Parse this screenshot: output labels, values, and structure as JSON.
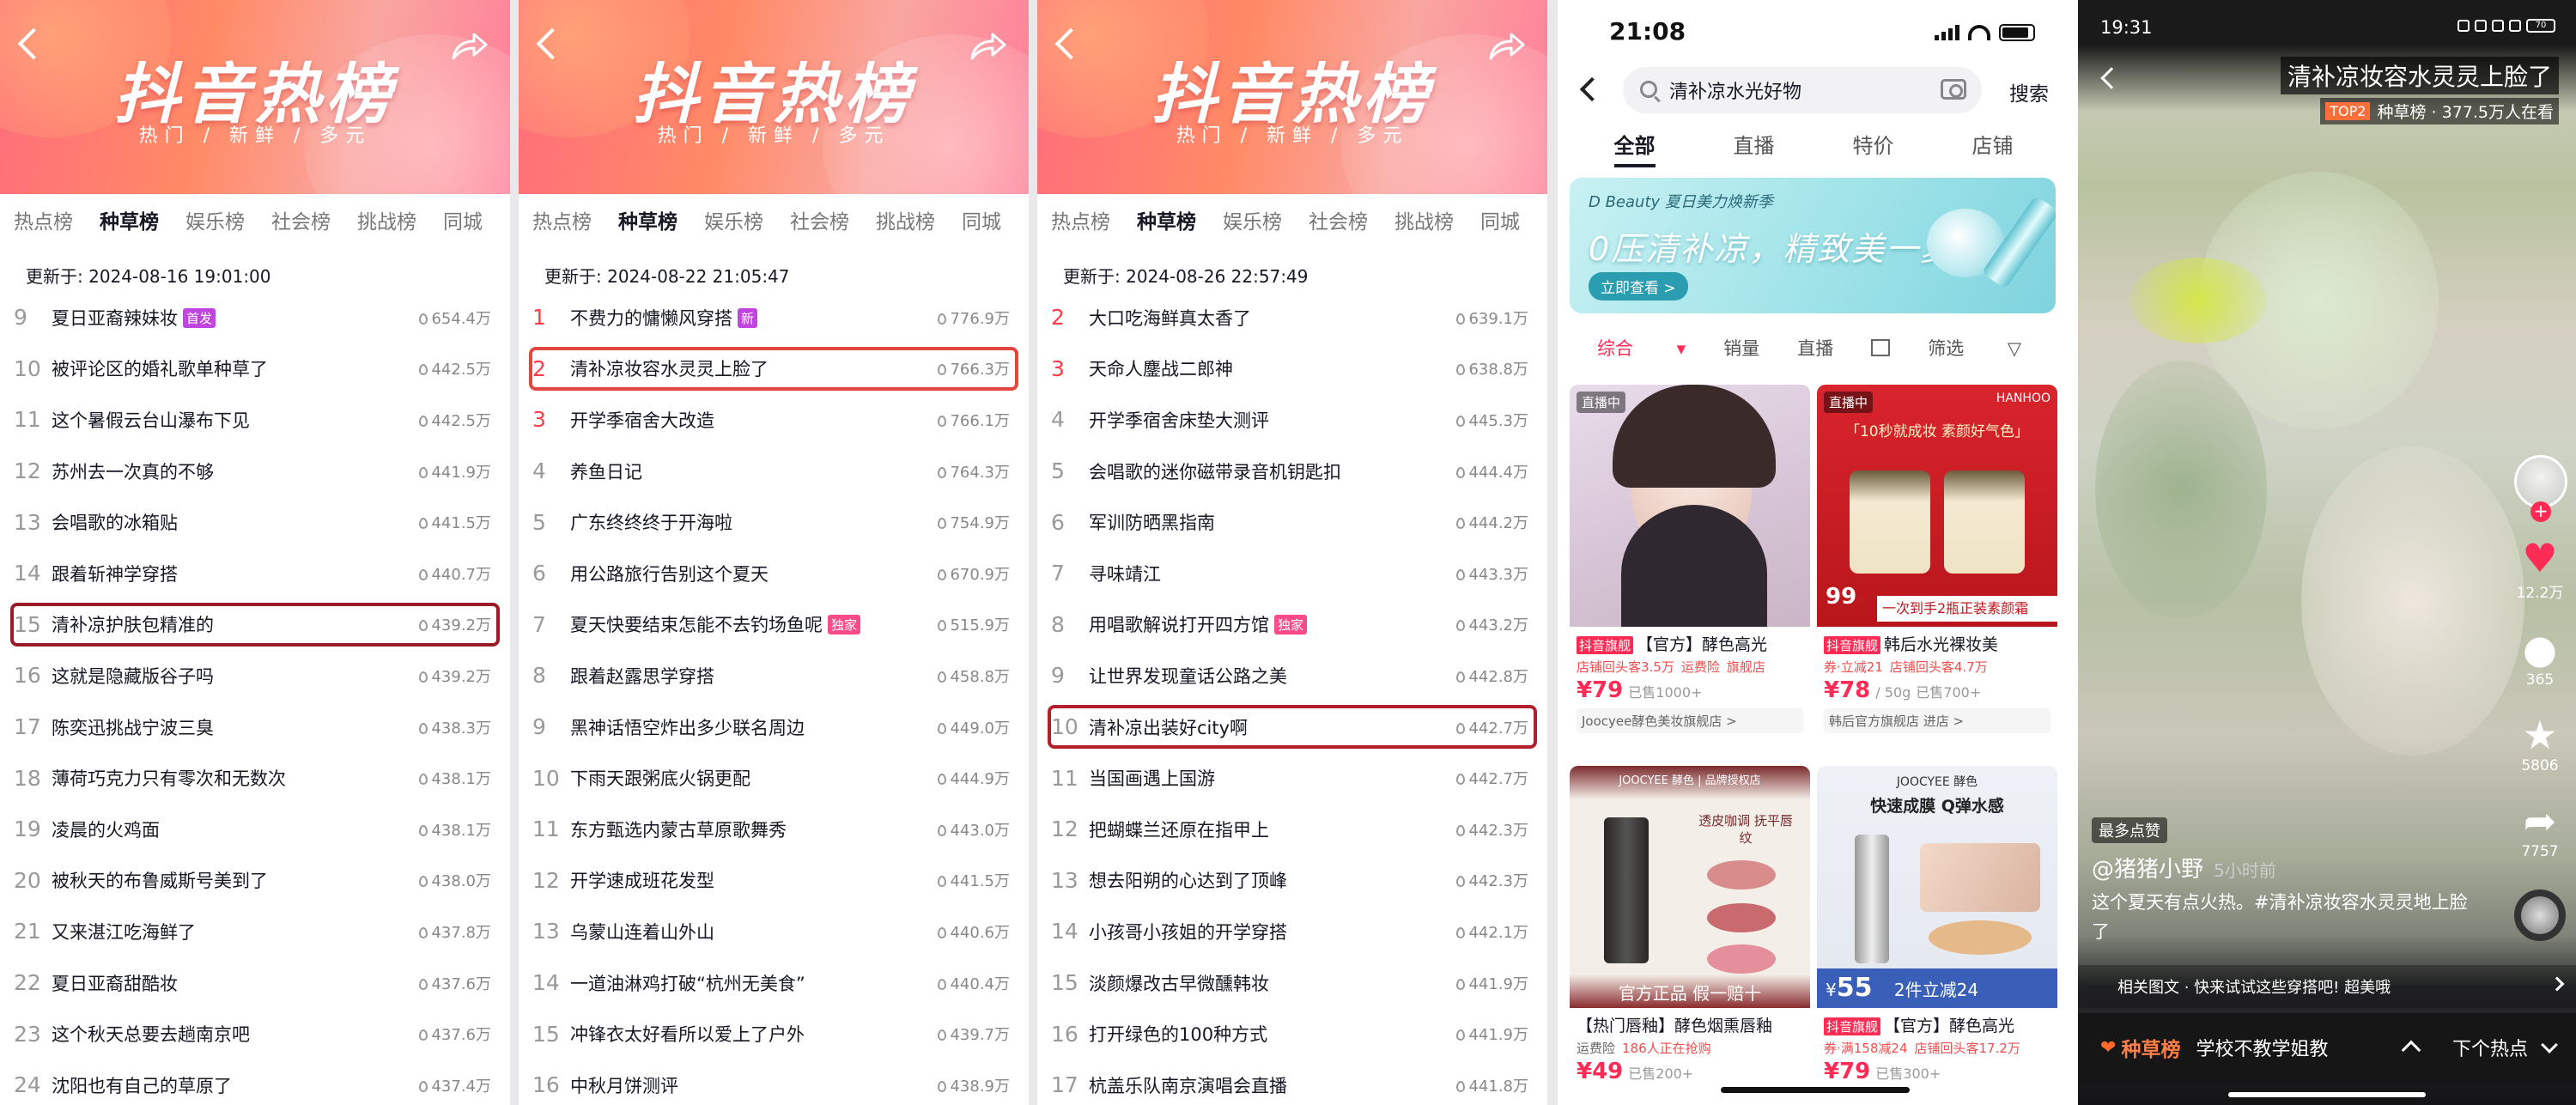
{
  "lists": [
    {
      "banner_title": "抖音热榜",
      "banner_sub": "热门 / 新鲜 / 多元",
      "tabs": [
        "热点榜",
        "种草榜",
        "娱乐榜",
        "社会榜",
        "挑战榜",
        "同城"
      ],
      "active_tab": "种草榜",
      "updated": "更新于:   2024-08-16 19:01:00",
      "rows": [
        {
          "rank": "9",
          "title": "夏日亚裔辣妹妆",
          "badge": "首发",
          "heat": "654.4万"
        },
        {
          "rank": "10",
          "title": "被评论区的婚礼歌单种草了",
          "heat": "442.5万"
        },
        {
          "rank": "11",
          "title": "这个暑假云台山瀑布下见",
          "heat": "442.5万"
        },
        {
          "rank": "12",
          "title": "苏州去一次真的不够",
          "heat": "441.9万"
        },
        {
          "rank": "13",
          "title": "会唱歌的冰箱贴",
          "heat": "441.5万"
        },
        {
          "rank": "14",
          "title": "跟着斩神学穿搭",
          "heat": "440.7万"
        },
        {
          "rank": "15",
          "title": "清补凉护肤包精准的",
          "heat": "439.2万",
          "boxed": true
        },
        {
          "rank": "16",
          "title": "这就是隐藏版谷子吗",
          "heat": "439.2万"
        },
        {
          "rank": "17",
          "title": "陈奕迅挑战宁波三臭",
          "heat": "438.3万"
        },
        {
          "rank": "18",
          "title": "薄荷巧克力只有零次和无数次",
          "heat": "438.1万"
        },
        {
          "rank": "19",
          "title": "凌晨的火鸡面",
          "heat": "438.1万"
        },
        {
          "rank": "20",
          "title": "被秋天的布鲁威斯号美到了",
          "heat": "438.0万"
        },
        {
          "rank": "21",
          "title": "又来湛江吃海鲜了",
          "heat": "437.8万"
        },
        {
          "rank": "22",
          "title": "夏日亚裔甜酷妆",
          "heat": "437.6万"
        },
        {
          "rank": "23",
          "title": "这个秋天总要去趟南京吧",
          "heat": "437.6万"
        },
        {
          "rank": "24",
          "title": "沈阳也有自己的草原了",
          "heat": "437.4万"
        }
      ]
    },
    {
      "banner_title": "抖音热榜",
      "banner_sub": "热门 / 新鲜 / 多元",
      "tabs": [
        "热点榜",
        "种草榜",
        "娱乐榜",
        "社会榜",
        "挑战榜",
        "同城"
      ],
      "active_tab": "种草榜",
      "updated": "更新于:   2024-08-22 21:05:47",
      "rows": [
        {
          "rank": "1",
          "title": "不费力的慵懒风穿搭",
          "badge": "新",
          "heat": "776.9万",
          "top": true
        },
        {
          "rank": "2",
          "title": "清补凉妆容水灵灵上脸了",
          "heat": "766.3万",
          "top": true,
          "boxed": true
        },
        {
          "rank": "3",
          "title": "开学季宿舍大改造",
          "heat": "766.1万",
          "top": true
        },
        {
          "rank": "4",
          "title": "养鱼日记",
          "heat": "764.3万"
        },
        {
          "rank": "5",
          "title": "广东终终终于开海啦",
          "heat": "754.9万"
        },
        {
          "rank": "6",
          "title": "用公路旅行告别这个夏天",
          "heat": "670.9万"
        },
        {
          "rank": "7",
          "title": "夏天快要结束怎能不去钓场鱼呢",
          "badge": "独家",
          "excl": true,
          "heat": "515.9万"
        },
        {
          "rank": "8",
          "title": "跟着赵露思学穿搭",
          "heat": "458.8万"
        },
        {
          "rank": "9",
          "title": "黑神话悟空炸出多少联名周边",
          "heat": "449.0万"
        },
        {
          "rank": "10",
          "title": "下雨天跟粥底火锅更配",
          "heat": "444.9万"
        },
        {
          "rank": "11",
          "title": "东方甄选内蒙古草原歌舞秀",
          "heat": "443.0万"
        },
        {
          "rank": "12",
          "title": "开学速成班花发型",
          "heat": "441.5万"
        },
        {
          "rank": "13",
          "title": "乌蒙山连着山外山",
          "heat": "440.6万"
        },
        {
          "rank": "14",
          "title": "一道油淋鸡打破“杭州无美食”",
          "heat": "440.4万"
        },
        {
          "rank": "15",
          "title": "冲锋衣太好看所以爱上了户外",
          "heat": "439.7万"
        },
        {
          "rank": "16",
          "title": "中秋月饼测评",
          "heat": "438.9万"
        }
      ]
    },
    {
      "banner_title": "抖音热榜",
      "banner_sub": "热门 / 新鲜 / 多元",
      "tabs": [
        "热点榜",
        "种草榜",
        "娱乐榜",
        "社会榜",
        "挑战榜",
        "同城"
      ],
      "active_tab": "种草榜",
      "updated": "更新于:   2024-08-26 22:57:49",
      "rows": [
        {
          "rank": "2",
          "title": "大口吃海鲜真太香了",
          "heat": "639.1万",
          "top": true
        },
        {
          "rank": "3",
          "title": "天命人鏖战二郎神",
          "heat": "638.8万",
          "top": true
        },
        {
          "rank": "4",
          "title": "开学季宿舍床垫大测评",
          "heat": "445.3万"
        },
        {
          "rank": "5",
          "title": "会唱歌的迷你磁带录音机钥匙扣",
          "heat": "444.4万"
        },
        {
          "rank": "6",
          "title": "军训防晒黑指南",
          "heat": "444.2万"
        },
        {
          "rank": "7",
          "title": "寻味靖江",
          "heat": "443.3万"
        },
        {
          "rank": "8",
          "title": "用唱歌解说打开四方馆",
          "badge": "独家",
          "excl": true,
          "heat": "443.2万"
        },
        {
          "rank": "9",
          "title": "让世界发现童话公路之美",
          "heat": "442.8万"
        },
        {
          "rank": "10",
          "title": "清补凉出装好city啊",
          "heat": "442.7万",
          "boxed": true
        },
        {
          "rank": "11",
          "title": "当国画遇上国游",
          "heat": "442.7万"
        },
        {
          "rank": "12",
          "title": "把蝴蝶兰还原在指甲上",
          "heat": "442.3万"
        },
        {
          "rank": "13",
          "title": "想去阳朔的心达到了顶峰",
          "heat": "442.3万"
        },
        {
          "rank": "14",
          "title": "小孩哥小孩姐的开学穿搭",
          "heat": "442.1万"
        },
        {
          "rank": "15",
          "title": "淡颜爆改古早微醺韩妆",
          "heat": "441.9万"
        },
        {
          "rank": "16",
          "title": "打开绿色的100种方式",
          "heat": "441.9万"
        },
        {
          "rank": "17",
          "title": "杭盖乐队南京演唱会直播",
          "heat": "441.8万"
        }
      ]
    }
  ],
  "search": {
    "time": "21:08",
    "query": "清补凉水光好物",
    "search_btn": "搜索",
    "tabs": [
      "全部",
      "直播",
      "特价",
      "店铺"
    ],
    "banner_brand": "D Beauty 夏日美力焕新季",
    "banner_headline": "0压清补凉，精致美一夏",
    "banner_cta": "立即查看 >",
    "filters": [
      "综合",
      "销量",
      "直播"
    ],
    "filter_end": "筛选",
    "products": [
      {
        "live": "直播中",
        "tag": "抖音旗舰",
        "title": "【官方】酵色高光",
        "meta": [
          "店铺回头客3.5万",
          "运费险",
          "旗舰店"
        ],
        "price": "¥79",
        "sold": "已售1000+",
        "shop": "Joocyee酵色美妆旗舰店 >"
      },
      {
        "live": "直播中",
        "tag": "抖音旗舰",
        "title": "韩后水光裸妆美",
        "meta": [
          "券·立减21",
          "店铺回头客4.7万"
        ],
        "price": "¥78",
        "unit": "/ 50g",
        "sold": "已售700+",
        "shop": "韩后官方旗舰店  进店 >",
        "img_text": "「10秒就成妆 素颜好气色」",
        "img_brand": "HANHOO",
        "img_price": "99",
        "img_deal": "一次到手2瓶正装素颜霜"
      },
      {
        "tag": "",
        "title": "【热门唇釉】酵色烟熏唇釉",
        "meta": [
          "运费险",
          "186人正在抢购"
        ],
        "price": "¥49",
        "sold": "已售200+",
        "img_brand": "JOOCYEE 酵色 | 品牌授权店",
        "img_text": "透皮咖调 抚平唇纹",
        "img_deal": "官方正品 假一赔十"
      },
      {
        "tag": "抖音旗舰",
        "title": "【官方】酵色高光",
        "meta": [
          "券·满158减24",
          "店铺回头客17.2万"
        ],
        "price": "¥79",
        "sold": "已售300+",
        "img_brand": "JOOCYEE 酵色",
        "img_text": "快速成膜 Q弹水感",
        "img_price": "55",
        "img_deal": "2件立减24"
      }
    ]
  },
  "video": {
    "time": "19:31",
    "battery": "70",
    "title": "清补凉妆容水灵灵上脸了",
    "top_badge": "TOP2",
    "rank_line": "种草榜 · 377.5万人在看",
    "likes": "12.2万",
    "comments": "365",
    "favorites": "5806",
    "shares": "7757",
    "badge": "最多点赞",
    "author": "@猪猪小野",
    "time_ago": "5小时前",
    "desc": "这个夏天有点火热。#清补凉妆容水灵灵地上脸了",
    "related": "相关图文 · 快来试试这些穿搭吧! 超美哦",
    "board": "种草榜",
    "board_query": "学校不教学姐教",
    "next": "下个热点"
  }
}
